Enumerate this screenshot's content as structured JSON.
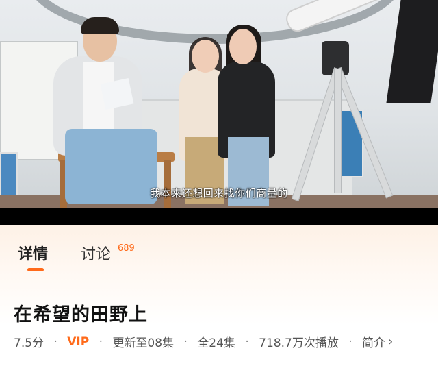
{
  "video": {
    "subtitle": "我本来还想回来找你们商量的"
  },
  "tabs": {
    "detail": "详情",
    "discuss": "讨论",
    "discuss_count": "689",
    "accent": "#ff6a1a"
  },
  "show": {
    "title": "在希望的田野上",
    "score": "7.5分",
    "vip": "VIP",
    "update": "更新至08集",
    "total": "全24集",
    "plays": "718.7万次播放",
    "intro": "简介"
  },
  "icons": {
    "chevron": "chevron-right-icon"
  }
}
